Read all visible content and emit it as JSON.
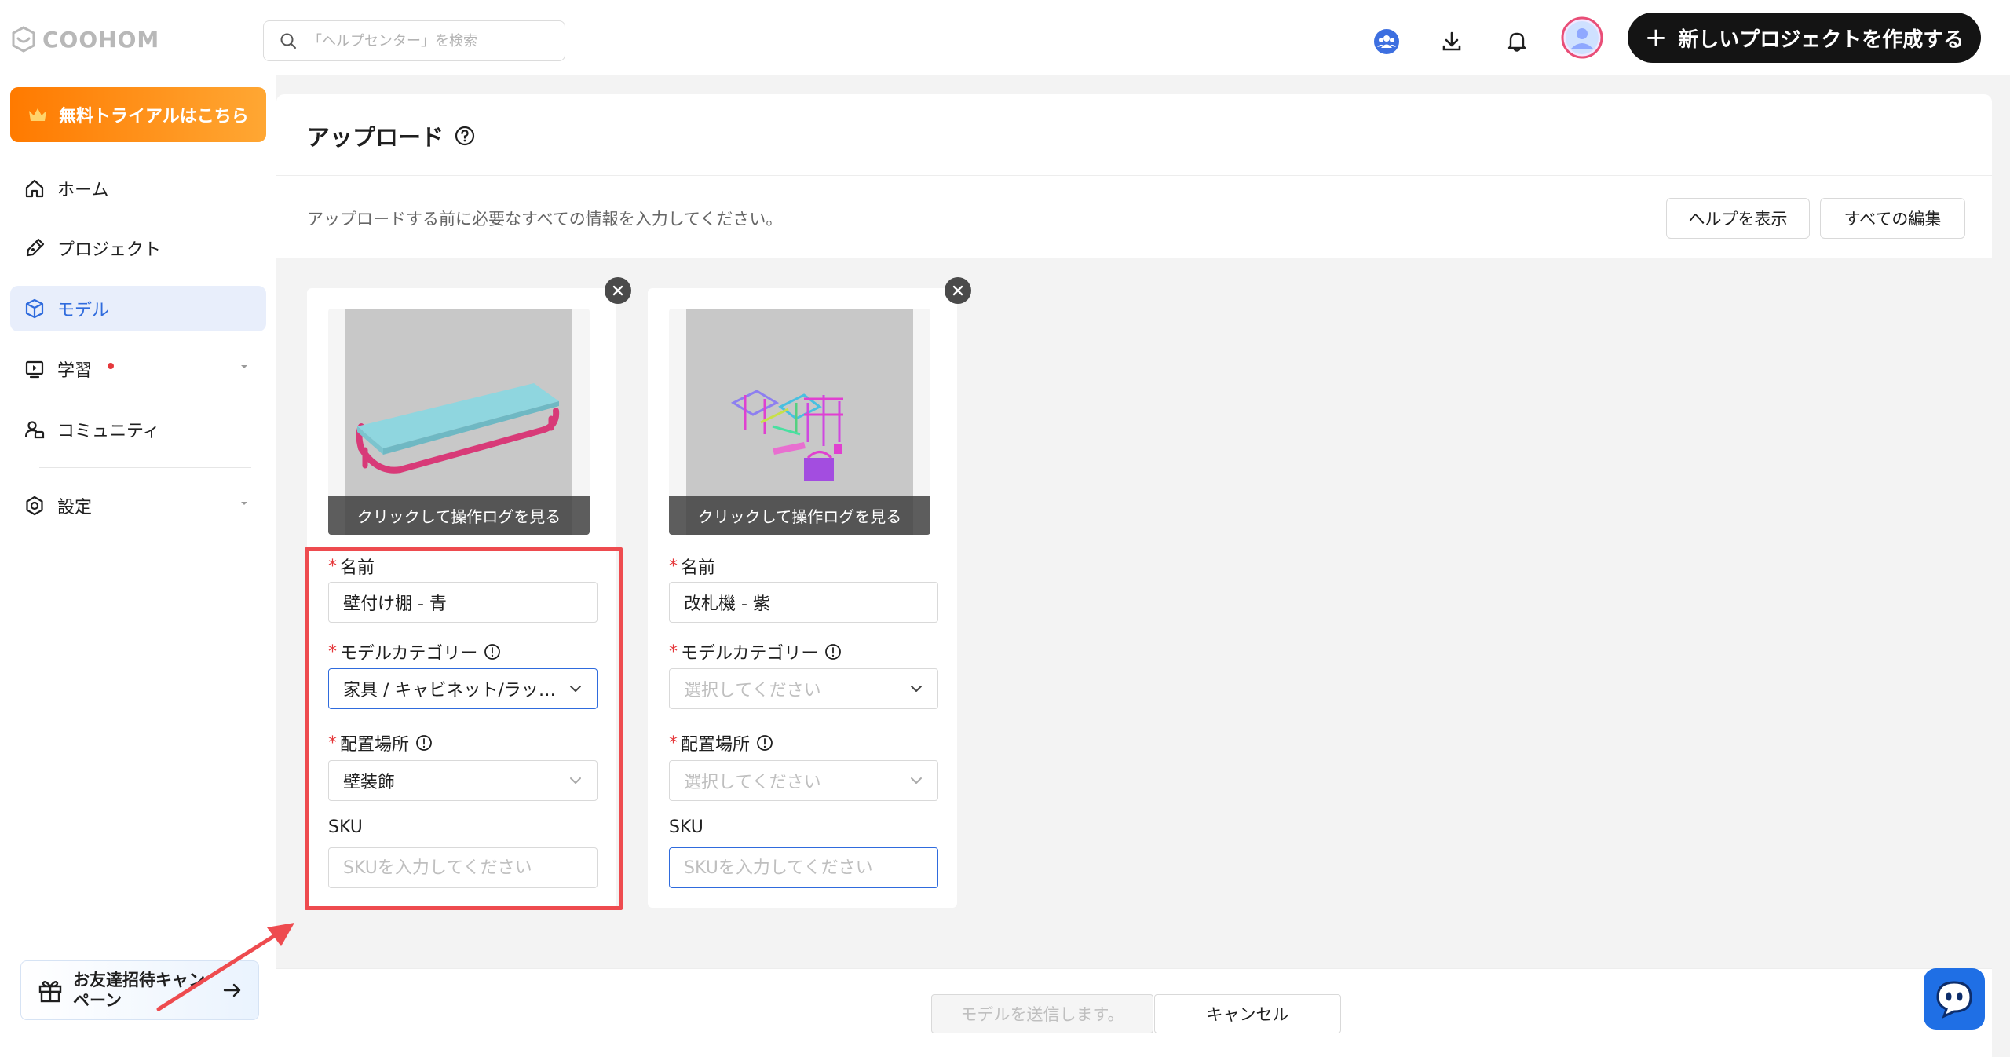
{
  "brand": {
    "name": "COOHOM"
  },
  "search": {
    "placeholder": "「ヘルプセンター」を検索"
  },
  "header": {
    "new_project_label": "新しいプロジェクトを作成する"
  },
  "sidebar": {
    "trial_label": "無料トライアルはこちら",
    "items": [
      {
        "label": "ホーム"
      },
      {
        "label": "プロジェクト"
      },
      {
        "label": "モデル"
      },
      {
        "label": "学習"
      },
      {
        "label": "コミュニティ"
      },
      {
        "label": "設定"
      }
    ],
    "invite_label": "お友達招待キャンペーン"
  },
  "page": {
    "title": "アップロード",
    "subtitle": "アップロードする前に必要なすべての情報を入力してください。",
    "help_label": "ヘルプを表示",
    "edit_all_label": "すべての編集"
  },
  "cards": [
    {
      "thumb_caption": "クリックして操作ログを見る",
      "name_label": "名前",
      "name_value": "壁付け棚 - 青",
      "category_label": "モデルカテゴリー",
      "category_value": "家具 / キャビネット/ラック/棚",
      "placement_label": "配置場所",
      "placement_value": "壁装飾",
      "sku_label": "SKU",
      "sku_placeholder": "SKUを入力してください"
    },
    {
      "thumb_caption": "クリックして操作ログを見る",
      "name_label": "名前",
      "name_value": "改札機 - 紫",
      "category_label": "モデルカテゴリー",
      "category_placeholder": "選択してください",
      "placement_label": "配置場所",
      "placement_placeholder": "選択してください",
      "sku_label": "SKU",
      "sku_placeholder": "SKUを入力してください"
    }
  ],
  "footer": {
    "submit_label": "モデルを送信します。",
    "cancel_label": "キャンセル"
  },
  "colors": {
    "accent": "#2f6bdd",
    "trial_orange": "#ff8a00",
    "highlight_red": "#ee4b4f",
    "required_red": "#e5383b",
    "dark_button": "#141414",
    "chat_blue": "#1f6fe5"
  }
}
